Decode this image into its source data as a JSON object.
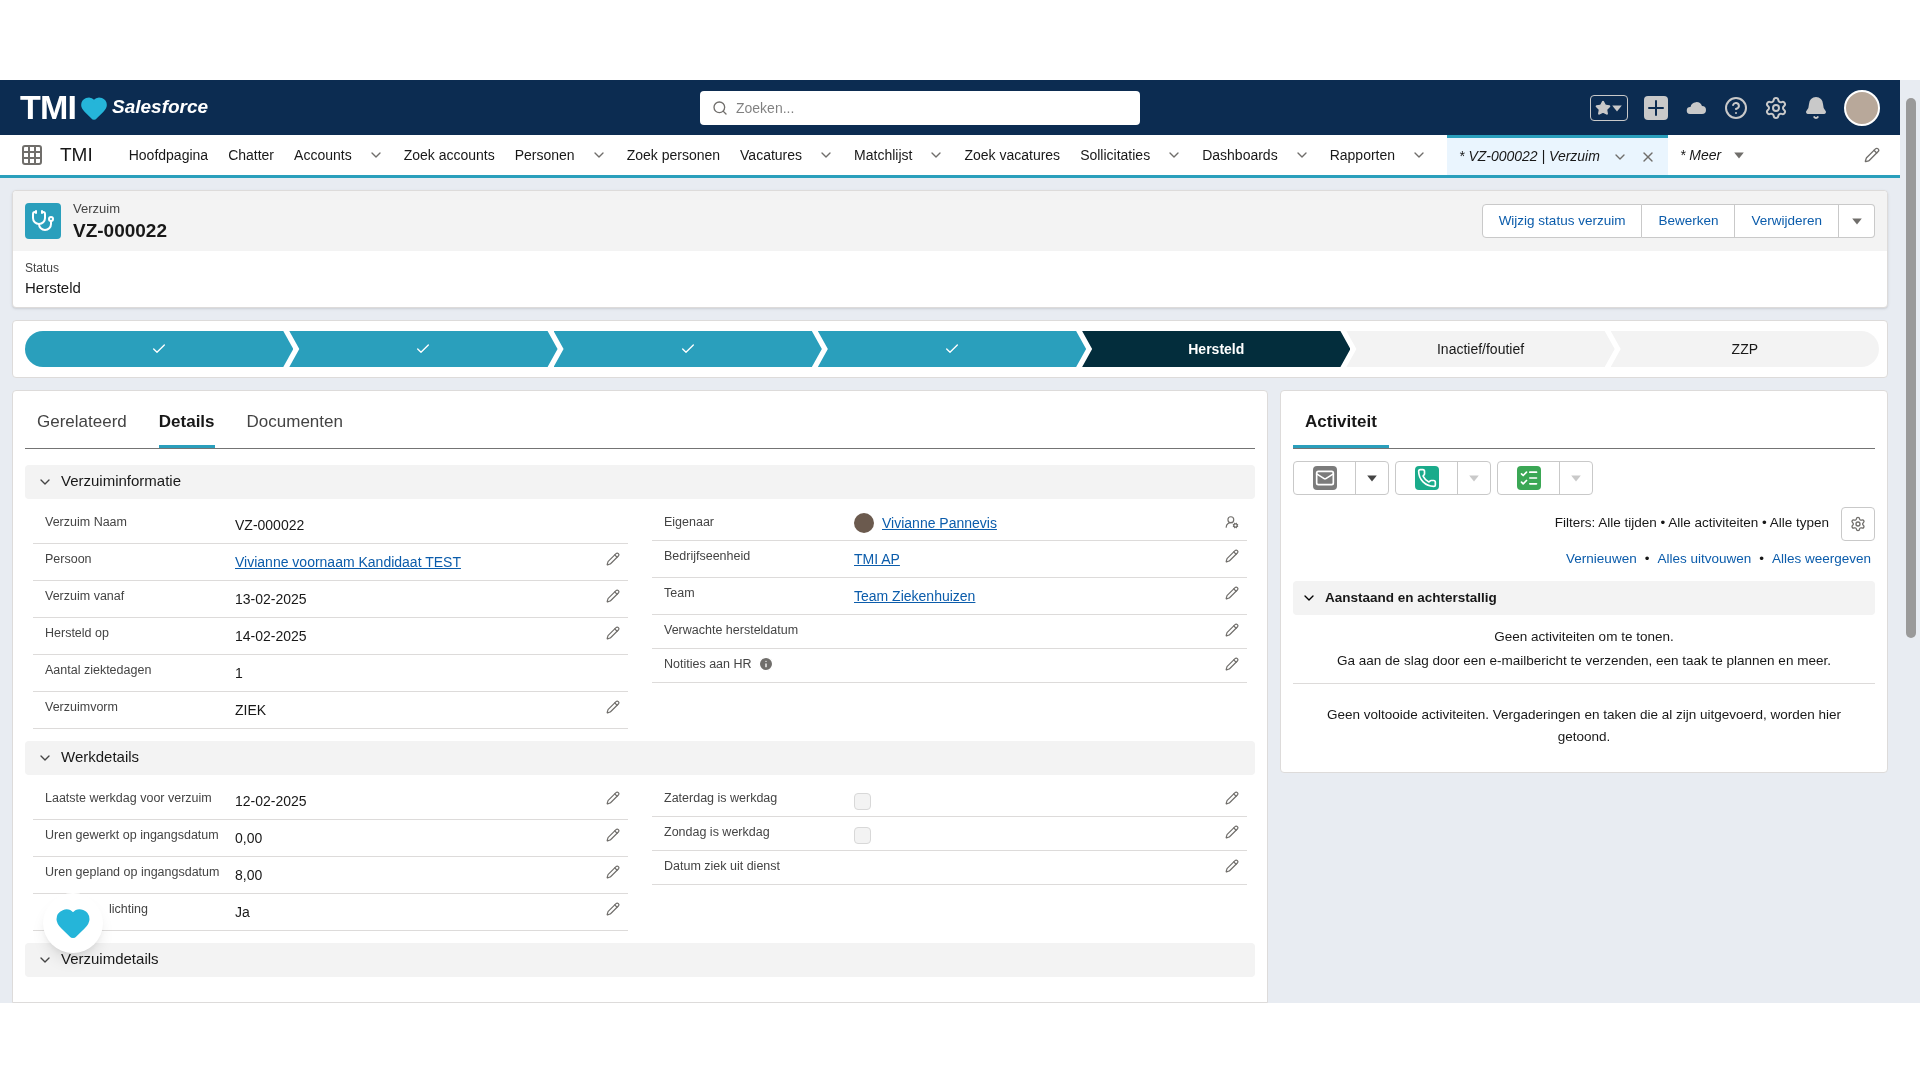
{
  "header": {
    "brand": "TMI",
    "brand_sub": "Salesforce",
    "search": {
      "placeholder": "Zoeken..."
    }
  },
  "nav": {
    "app_name": "TMI",
    "items": [
      {
        "label": "Hoofdpagina",
        "dropdown": false,
        "selected": false
      },
      {
        "label": "Chatter",
        "dropdown": false,
        "selected": false
      },
      {
        "label": "Accounts",
        "dropdown": true,
        "selected": false
      },
      {
        "label": "Zoek accounts",
        "dropdown": false,
        "selected": false
      },
      {
        "label": "Personen",
        "dropdown": true,
        "selected": false
      },
      {
        "label": "Zoek personen",
        "dropdown": false,
        "selected": false
      },
      {
        "label": "Vacatures",
        "dropdown": true,
        "selected": false
      },
      {
        "label": "Matchlijst",
        "dropdown": true,
        "selected": false
      },
      {
        "label": "Zoek vacatures",
        "dropdown": false,
        "selected": false
      },
      {
        "label": "Sollicitaties",
        "dropdown": true,
        "selected": false
      },
      {
        "label": "Dashboards",
        "dropdown": true,
        "selected": false
      },
      {
        "label": "Rapporten",
        "dropdown": true,
        "selected": false
      }
    ],
    "record_tab": {
      "label": "* VZ-000022 | Verzuim",
      "selected": true
    },
    "more": "* Meer"
  },
  "record": {
    "type": "Verzuim",
    "name": "VZ-000022",
    "actions": [
      "Wijzig status verzuim",
      "Bewerken",
      "Verwijderen"
    ],
    "status_label": "Status",
    "status_value": "Hersteld"
  },
  "path": [
    {
      "complete": true,
      "selected": false
    },
    {
      "complete": true,
      "selected": false
    },
    {
      "complete": true,
      "selected": false
    },
    {
      "complete": true,
      "selected": false
    },
    {
      "label": "Hersteld",
      "complete": false,
      "selected": true
    },
    {
      "label": "Inactief/foutief",
      "complete": false,
      "selected": false
    },
    {
      "label": "ZZP",
      "complete": false,
      "selected": false
    }
  ],
  "tabs": [
    {
      "label": "Gerelateerd",
      "selected": false
    },
    {
      "label": "Details",
      "selected": true
    },
    {
      "label": "Documenten",
      "selected": false
    }
  ],
  "sections": [
    {
      "title": "Verzuiminformatie",
      "expanded": true,
      "left": [
        {
          "label": "Verzuim Naam",
          "value": "VZ-000022",
          "kind": "text",
          "editable": false
        },
        {
          "label": "Persoon",
          "value": "Vivianne voornaam Kandidaat TEST",
          "kind": "link",
          "editable": true
        },
        {
          "label": "Verzuim vanaf",
          "value": "13-02-2025",
          "kind": "text",
          "editable": true
        },
        {
          "label": "Hersteld op",
          "value": "14-02-2025",
          "kind": "text",
          "editable": true
        },
        {
          "label": "Aantal ziektedagen",
          "value": "1",
          "kind": "text",
          "editable": false
        },
        {
          "label": "Verzuimvorm",
          "value": "ZIEK",
          "kind": "text",
          "editable": true
        }
      ],
      "right": [
        {
          "label": "Eigenaar",
          "value": "Vivianne Pannevis",
          "kind": "owner",
          "editable": false
        },
        {
          "label": "Bedrijfseenheid",
          "value": "TMI AP",
          "kind": "link",
          "editable": true
        },
        {
          "label": "Team",
          "value": "Team Ziekenhuizen",
          "kind": "link",
          "editable": true
        },
        {
          "label": "Verwachte hersteldatum",
          "kind": "text",
          "editable": true
        },
        {
          "label": "Notities aan HR",
          "kind": "info",
          "editable": true
        }
      ]
    },
    {
      "title": "Werkdetails",
      "expanded": true,
      "left": [
        {
          "label": "Laatste werkdag voor verzuim",
          "value": "12-02-2025",
          "kind": "text",
          "editable": true
        },
        {
          "label": "Uren gewerkt op ingangsdatum",
          "value": "0,00",
          "kind": "text",
          "editable": true
        },
        {
          "label": "Uren gepland op ingangsdatum",
          "value": "8,00",
          "kind": "text",
          "editable": true
        },
        {
          "label": "lichting",
          "value": "Ja",
          "kind": "text",
          "editable": true,
          "covered": true
        }
      ],
      "right": [
        {
          "label": "Zaterdag is werkdag",
          "kind": "checkbox",
          "checked": false,
          "editable": true
        },
        {
          "label": "Zondag is werkdag",
          "kind": "checkbox",
          "checked": false,
          "editable": true
        },
        {
          "label": "Datum ziek uit dienst",
          "kind": "text",
          "editable": true
        }
      ]
    },
    {
      "title": "Verzuimdetails",
      "expanded": true
    }
  ],
  "activity": {
    "title": "Activiteit",
    "filters": "Filters: Alle tijden • Alle activiteiten • Alle typen",
    "links": [
      "Vernieuwen",
      "Alles uitvouwen",
      "Alles weergeven"
    ],
    "link_separator": "•",
    "upcoming": {
      "title": "Aanstaand en achterstallig",
      "expanded": true,
      "empty_title": "Geen activiteiten om te tonen.",
      "empty_text": "Ga aan de slag door een e-mailbericht te verzenden, een taak te plannen en meer."
    },
    "past_text": "Geen voltooide activiteiten. Vergaderingen en taken die al zijn uitgevoerd, worden hier getoond."
  }
}
